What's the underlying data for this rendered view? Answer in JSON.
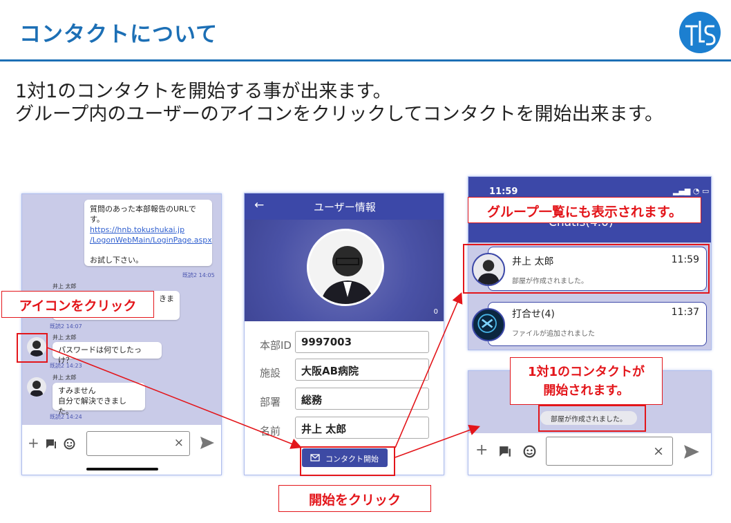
{
  "title": "コンタクトについて",
  "intro": {
    "line1": "1対1のコンタクトを開始する事が出来ます。",
    "line2": "グループ内のユーザーのアイコンをクリックしてコンタクトを開始出来ます。"
  },
  "chat": {
    "msg1": {
      "line1": "質問のあった本部報告のURLで",
      "line2": "す。",
      "link1": "https://hnb.tokushukai.jp",
      "link2": "/LogonWebMain/LoginPage.aspx",
      "line3": "お試し下さい。",
      "read": "既読2 14:05"
    },
    "msg2": {
      "sender": "井上 太郎",
      "text": "きま",
      "read": "既読2 14:07"
    },
    "msg3": {
      "sender": "井上 太郎",
      "text": "パスワードは何でしたっけ？",
      "read": "既読2 14:23"
    },
    "msg4": {
      "sender": "井上 太郎",
      "line1": "すみません",
      "line2": "自分で解決できました。",
      "read": "既読2 14:24"
    },
    "clear": "×"
  },
  "user_info": {
    "back": "←",
    "header": "ユーザー情報",
    "bell_count": "0",
    "fields": [
      {
        "label": "本部ID",
        "value": "9997003"
      },
      {
        "label": "施設",
        "value": "大阪AB病院"
      },
      {
        "label": "部署",
        "value": "総務"
      },
      {
        "label": "名前",
        "value": "井上 太郎"
      }
    ],
    "contact_button": "コンタクト開始"
  },
  "group_list": {
    "time": "11:59",
    "app_title": "Chatis(4.0)",
    "items": [
      {
        "name": "井上 太郎",
        "time": "11:59",
        "message": "部屋が作成されました。"
      },
      {
        "name": "打合せ(4)",
        "time": "11:37",
        "message": "ファイルが追加されました"
      }
    ]
  },
  "new_chat": {
    "system_message": "部屋が作成されました。",
    "clear": "×"
  },
  "callouts": {
    "icon_click": "アイコンをクリック",
    "start_click": "開始をクリック",
    "group_list_shown": "グループ一覧にも表示されます。",
    "contact_started_1": "1対1のコンタクトが",
    "contact_started_2": "開始されます。"
  },
  "colors": {
    "accent": "#1c6fb5",
    "app_primary": "#3c48a8",
    "callout_red": "#e3151a"
  }
}
